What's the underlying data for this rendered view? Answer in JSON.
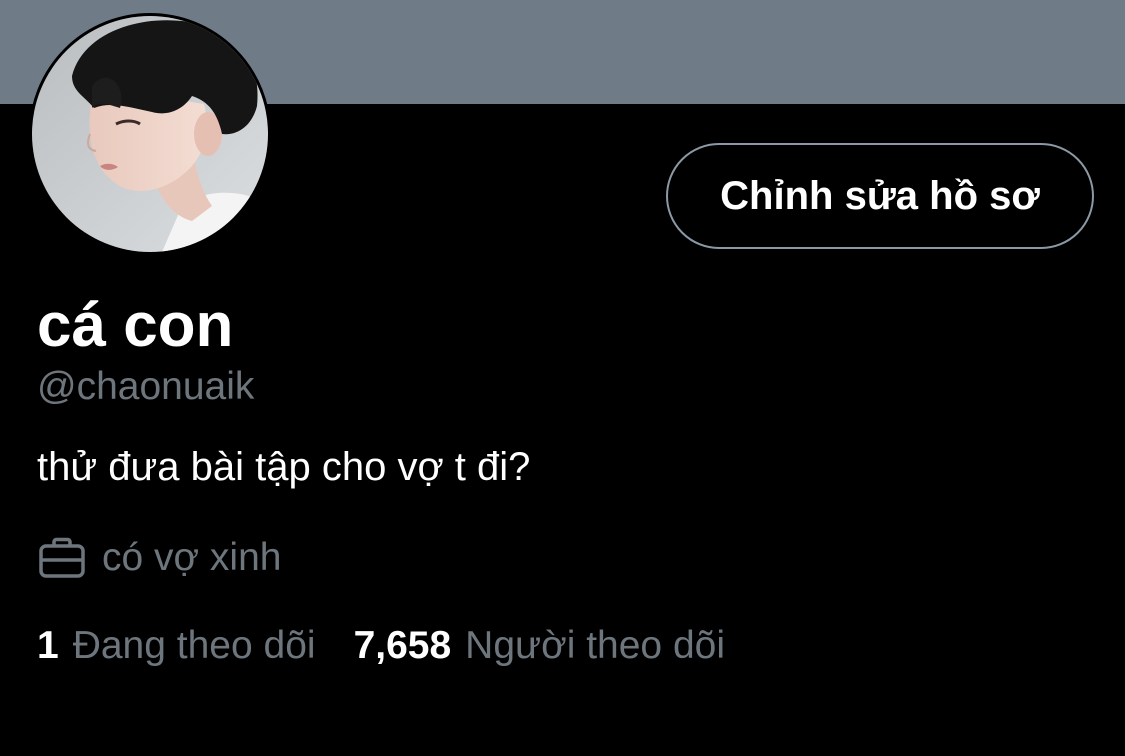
{
  "colors": {
    "background": "#000000",
    "banner": "#6f7b87",
    "text_primary": "#ffffff",
    "text_secondary": "#6e767d",
    "button_border": "#8b98a5"
  },
  "profile": {
    "edit_button_label": "Chỉnh sửa hồ sơ",
    "display_name": "cá con",
    "handle": "@chaonuaik",
    "bio": "thử đưa bài tập cho vợ t đi?",
    "work": {
      "icon": "briefcase-icon",
      "text": "có vợ xinh"
    },
    "stats": {
      "following_count": "1",
      "following_label": "Đang theo dõi",
      "followers_count": "7,658",
      "followers_label": "Người theo dõi"
    }
  }
}
